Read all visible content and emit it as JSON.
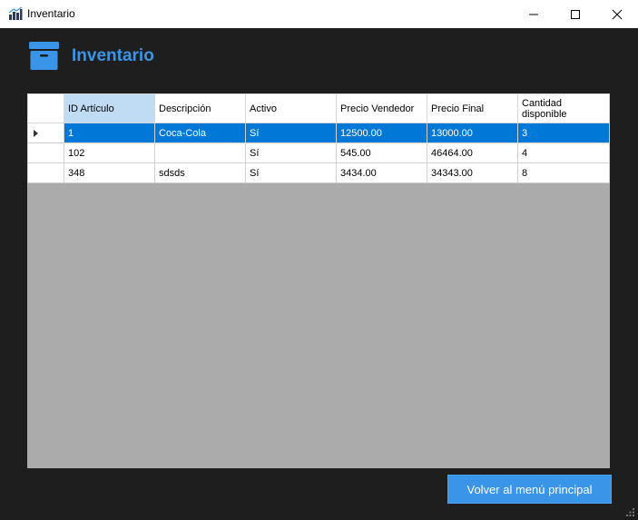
{
  "window": {
    "title": "Inventario"
  },
  "header": {
    "title": "Inventario",
    "icon": "archive-box-icon"
  },
  "grid": {
    "columns": [
      "ID Artículo",
      "Descripción",
      "Activo",
      "Precio Vendedor",
      "Precio Final",
      "Cantidad disponible"
    ],
    "rows": [
      {
        "id": "1",
        "descripcion": "Coca-Cola",
        "activo": "Sí",
        "precio_vendedor": "12500.00",
        "precio_final": "13000.00",
        "cantidad": "3"
      },
      {
        "id": "102",
        "descripcion": "",
        "activo": "Sí",
        "precio_vendedor": "545.00",
        "precio_final": "46464.00",
        "cantidad": "4"
      },
      {
        "id": "348",
        "descripcion": "sdsds",
        "activo": "Sí",
        "precio_vendedor": "3434.00",
        "precio_final": "34343.00",
        "cantidad": "8"
      }
    ],
    "selected_row": 0
  },
  "footer": {
    "back_button_label": "Volver al menú principal"
  },
  "colors": {
    "accent": "#3a95e8",
    "selection": "#0078d7",
    "background": "#1e1e1e",
    "grid_empty": "#ababab"
  }
}
